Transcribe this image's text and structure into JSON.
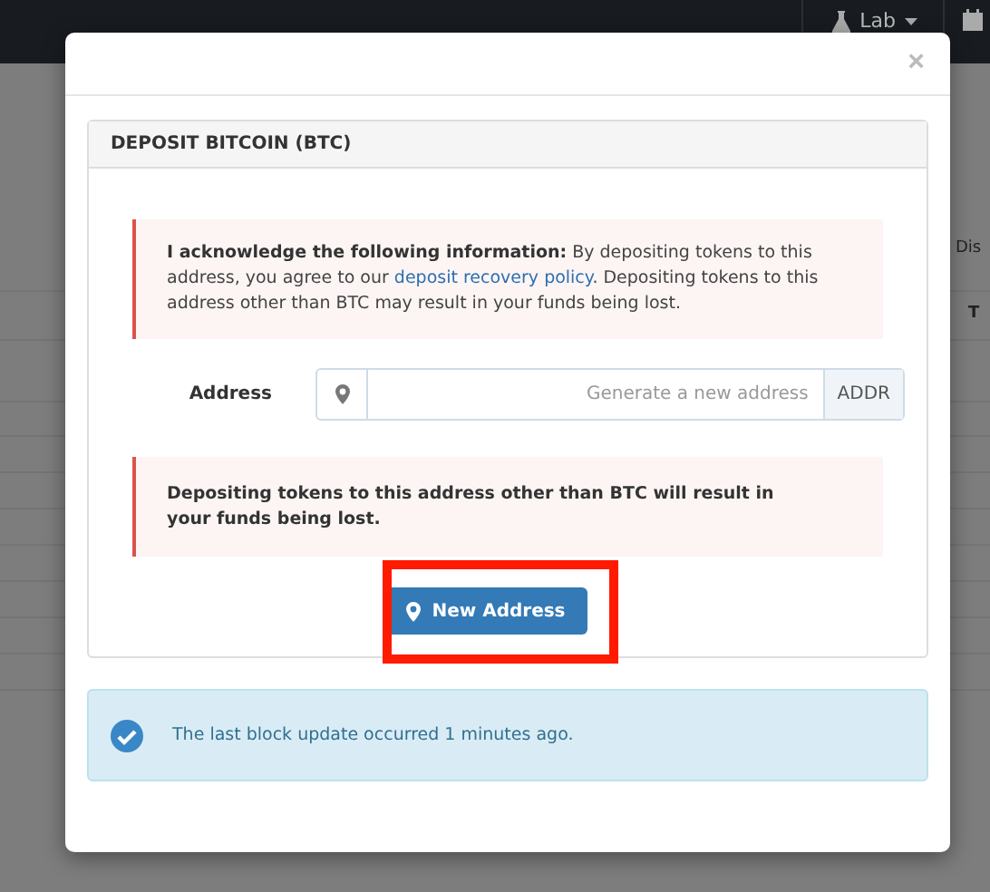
{
  "navbar": {
    "menu_label": "Lab"
  },
  "background": {
    "column_label": "Dis",
    "table_header": "T"
  },
  "modal": {
    "close": "×",
    "panel_title": "DEPOSIT BITCOIN (BTC)",
    "notice": {
      "lead": "I acknowledge the following information:",
      "before": " By depositing tokens to this address, you agree to our ",
      "link": "deposit recovery policy",
      "after": ". Depositing tokens to this address other than BTC may result in your funds being lost."
    },
    "address": {
      "label": "Address",
      "placeholder": "Generate a new address",
      "addon": "ADDR"
    },
    "warning": "Depositing tokens to this address other than BTC will result in your funds being lost.",
    "button": "New Address",
    "highlighted": true,
    "info": "The last block update occurred 1 minutes ago."
  }
}
